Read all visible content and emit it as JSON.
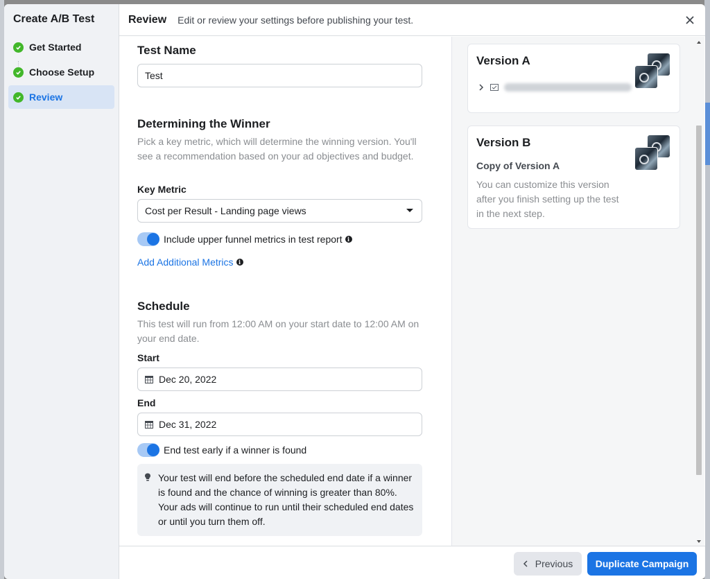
{
  "sidebar": {
    "title": "Create A/B Test",
    "steps": [
      {
        "label": "Get Started",
        "done": true,
        "active": false
      },
      {
        "label": "Choose Setup",
        "done": true,
        "active": false
      },
      {
        "label": "Review",
        "done": true,
        "active": true
      }
    ]
  },
  "header": {
    "title": "Review",
    "subtitle": "Edit or review your settings before publishing your test."
  },
  "test_name": {
    "title": "Test Name",
    "value": "Test"
  },
  "winner": {
    "title": "Determining the Winner",
    "description": "Pick a key metric, which will determine the winning version. You'll see a recommendation based on your ad objectives and budget.",
    "key_metric_label": "Key Metric",
    "key_metric_value": "Cost per Result - Landing page views",
    "upper_funnel_label": "Include upper funnel metrics in test report",
    "upper_funnel_on": true,
    "add_metrics_link": "Add Additional Metrics"
  },
  "schedule": {
    "title": "Schedule",
    "description": "This test will run from 12:00 AM on your start date to 12:00 AM on your end date.",
    "start_label": "Start",
    "start_value": "Dec 20, 2022",
    "end_label": "End",
    "end_value": "Dec 31, 2022",
    "end_early_label": "End test early if a winner is found",
    "end_early_on": true,
    "tip": "Your test will end before the scheduled end date if a winner is found and the chance of winning is greater than 80%. Your ads will continue to run until their scheduled end dates or until you turn them off."
  },
  "versions": {
    "a": {
      "title": "Version A"
    },
    "b": {
      "title": "Version B",
      "subtitle": "Copy of Version A",
      "description": "You can customize this version after you finish setting up the test in the next step."
    }
  },
  "footer": {
    "previous_label": "Previous",
    "primary_label": "Duplicate Campaign"
  },
  "colors": {
    "accent": "#1b74e4",
    "success": "#42b72a"
  }
}
